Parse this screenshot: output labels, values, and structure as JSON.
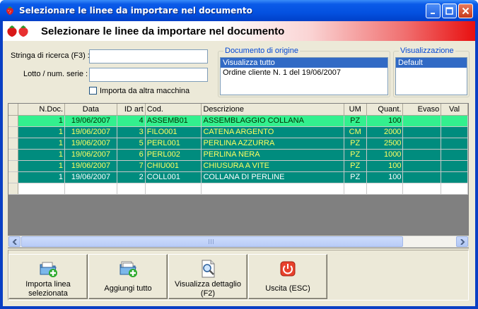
{
  "window": {
    "title": "Selezionare le linee da importare nel documento"
  },
  "header": {
    "title": "Selezionare le linee da importare nel documento"
  },
  "search": {
    "search_label": "Stringa di ricerca (F3) :",
    "search_value": "",
    "lot_label": "Lotto / num. serie :",
    "lot_value": "",
    "import_other_label": "Importa da altra macchina",
    "import_other_checked": false
  },
  "origin": {
    "title": "Documento di origine",
    "items": [
      "Visualizza tutto",
      "Ordine cliente N. 1 del 19/06/2007"
    ],
    "selected": 0
  },
  "view": {
    "title": "Visualizzazione",
    "items": [
      "Default"
    ],
    "selected": 0
  },
  "grid": {
    "columns": [
      "N.Doc.",
      "Data",
      "ID art",
      "Cod.",
      "Descrizione",
      "UM",
      "Quant.",
      "Evaso",
      "Val"
    ],
    "rows": [
      [
        "1",
        "19/06/2007",
        "4",
        "ASSEMB01",
        "ASSEMBLAGGIO COLLANA",
        "PZ",
        "100",
        "",
        ""
      ],
      [
        "1",
        "19/06/2007",
        "3",
        "FILO001",
        "CATENA ARGENTO",
        "CM",
        "2000",
        "",
        ""
      ],
      [
        "1",
        "19/06/2007",
        "5",
        "PERL001",
        "PERLINA AZZURRA",
        "PZ",
        "2500",
        "",
        ""
      ],
      [
        "1",
        "19/06/2007",
        "6",
        "PERL002",
        "PERLINA NERA",
        "PZ",
        "1000",
        "",
        ""
      ],
      [
        "1",
        "19/06/2007",
        "7",
        "CHIU001",
        "CHIUSURA A VITE",
        "PZ",
        "100",
        "",
        ""
      ],
      [
        "1",
        "19/06/2007",
        "2",
        "COLL001",
        "COLLANA DI PERLINE",
        "PZ",
        "100",
        "",
        ""
      ]
    ]
  },
  "buttons": {
    "import_selected": "Importa linea selezionata",
    "add_all": "Aggiungi tutto",
    "view_detail": "Visualizza dettaglio (F2)",
    "exit": "Uscita (ESC)"
  },
  "colors": {
    "selected_row": "#33f08e",
    "row": "#008c7e",
    "row_text": "#ffff60",
    "title_bar": "#0451e0"
  }
}
